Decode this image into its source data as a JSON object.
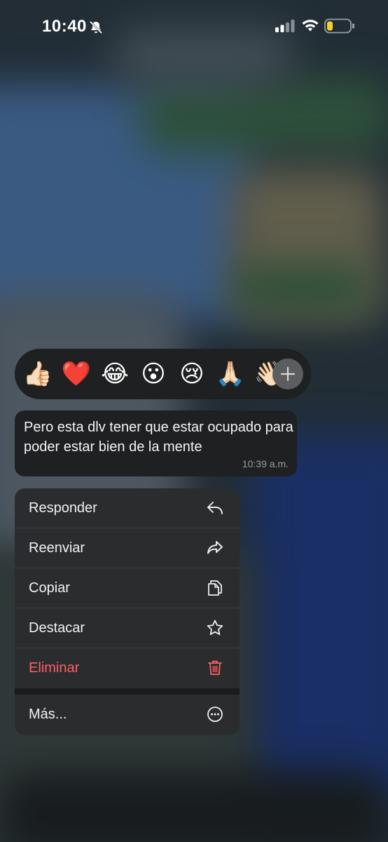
{
  "status_bar": {
    "time": "10:40",
    "battery_color": "#f5d130"
  },
  "reactions": {
    "emojis": [
      "👍🏻",
      "❤️",
      "😂",
      "😮",
      "😢",
      "🙏🏻",
      "👋🏻"
    ],
    "more_icon": "plus-icon"
  },
  "message": {
    "text": "Pero esta dlv tener que estar ocupado para poder estar bien de la mente",
    "time": "10:39 a.m."
  },
  "menu": {
    "items": [
      {
        "label": "Responder",
        "icon": "reply-icon"
      },
      {
        "label": "Reenviar",
        "icon": "forward-icon"
      },
      {
        "label": "Copiar",
        "icon": "copy-icon"
      },
      {
        "label": "Destacar",
        "icon": "star-icon"
      },
      {
        "label": "Eliminar",
        "icon": "trash-icon",
        "color": "#ff5f66"
      },
      {
        "label": "Más...",
        "icon": "more-icon"
      }
    ]
  }
}
